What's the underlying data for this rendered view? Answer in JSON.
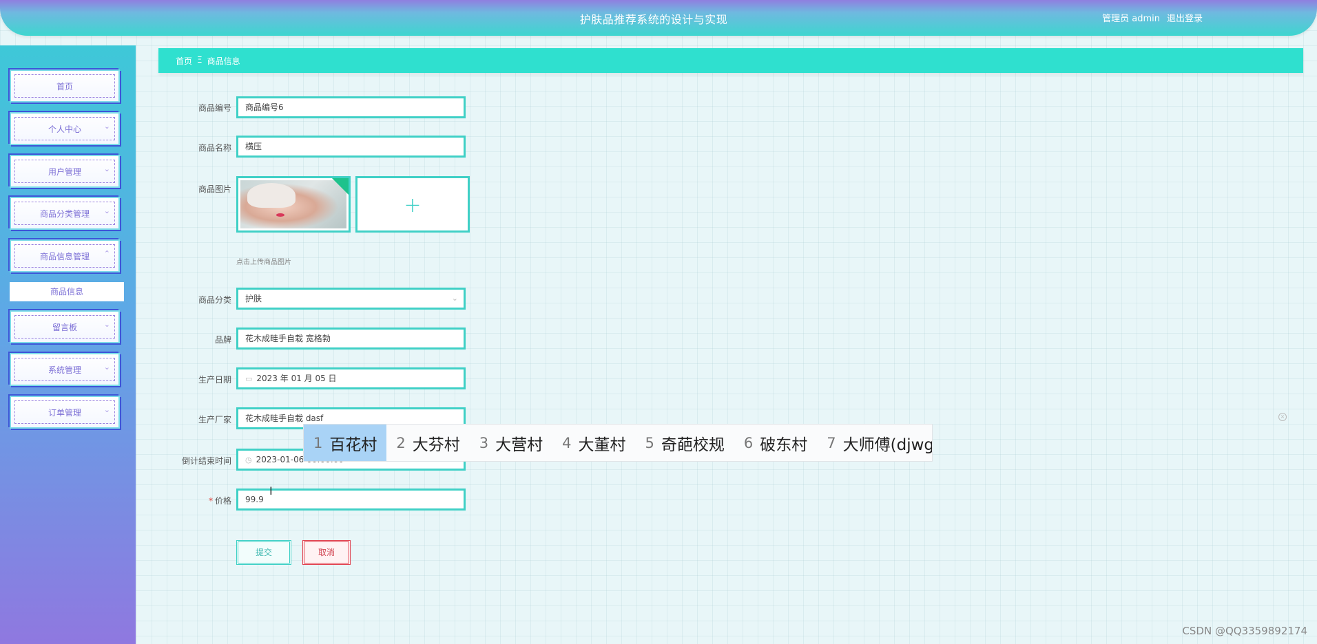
{
  "header": {
    "title": "护肤品推荐系统的设计与实现",
    "user_label": "管理员 admin",
    "logout_label": "退出登录"
  },
  "sidebar": {
    "items": [
      {
        "label": "首页",
        "expandable": false
      },
      {
        "label": "个人中心",
        "expandable": true
      },
      {
        "label": "用户管理",
        "expandable": true
      },
      {
        "label": "商品分类管理",
        "expandable": true
      },
      {
        "label": "商品信息管理",
        "expandable": true,
        "expanded": true
      },
      {
        "label": "留言板",
        "expandable": true
      },
      {
        "label": "系统管理",
        "expandable": true
      },
      {
        "label": "订单管理",
        "expandable": true
      }
    ],
    "sub_item": "商品信息"
  },
  "breadcrumb": {
    "home": "首页",
    "separator": "Ξ",
    "current": "商品信息"
  },
  "form": {
    "product_no": {
      "label": "商品编号",
      "value": "商品编号6"
    },
    "product_name": {
      "label": "商品名称",
      "value": "横压"
    },
    "product_image": {
      "label": "商品图片",
      "hint": "点击上传商品图片"
    },
    "category": {
      "label": "商品分类",
      "value": "护肤"
    },
    "brand": {
      "label": "品牌",
      "value": "花木成畦手自栽 宽格勃"
    },
    "production_date": {
      "label": "生产日期",
      "value": "2023 年 01 月 05 日"
    },
    "manufacturer": {
      "label": "生产厂家",
      "value": "花木成畦手自栽 dasf"
    },
    "countdown_end": {
      "label": "倒计结束时间",
      "value": "2023-01-06 00:00:00"
    },
    "price": {
      "label": "价格",
      "value": "99.9",
      "required": true
    },
    "submit_label": "提交",
    "cancel_label": "取消"
  },
  "ime": {
    "candidates": [
      {
        "num": "1",
        "text": "百花村",
        "selected": true
      },
      {
        "num": "2",
        "text": "大芬村"
      },
      {
        "num": "3",
        "text": "大营村"
      },
      {
        "num": "4",
        "text": "大董村"
      },
      {
        "num": "5",
        "text": "奇葩校规"
      },
      {
        "num": "6",
        "text": "破东村"
      },
      {
        "num": "7",
        "text": "大师傅(djwg"
      }
    ]
  },
  "watermark": "CSDN @QQ3359892174",
  "colors": {
    "accent": "#3fd0c6",
    "header_gradient_start": "#8f7fe0",
    "header_gradient_end": "#3ed6cf",
    "sidebar_text": "#7c6fd6",
    "cancel": "#e0414f",
    "ime_selected": "#a9d3f6"
  }
}
